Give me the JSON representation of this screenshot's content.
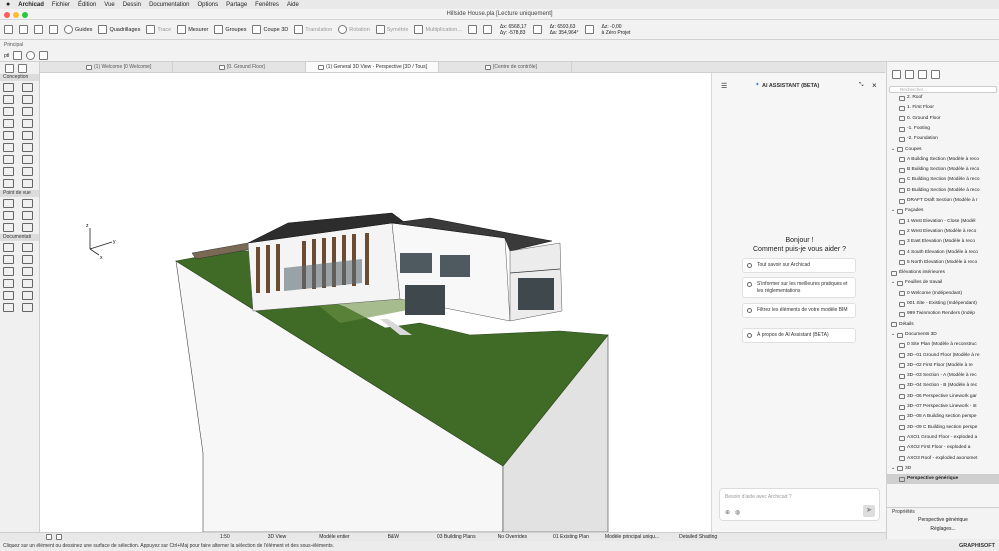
{
  "menubar": {
    "app": "Archicad",
    "items": [
      "Fichier",
      "Édition",
      "Vue",
      "Dessin",
      "Documentation",
      "Options",
      "Partage",
      "Fenêtres",
      "Aide"
    ]
  },
  "window": {
    "title": "Hillside House.pla [Lecture uniquement]"
  },
  "toolbar": {
    "guides": "Guides",
    "quadrillages": "Quadrillages",
    "trace": "Trace",
    "mesurer": "Mesurer",
    "groupes": "Groupes",
    "coupe3d": "Coupe 3D",
    "translation": "Translation",
    "rotation": "Rotation",
    "symetrie": "Symétrie",
    "multiplication": "Multiplication...",
    "dx": "Δx: 6568,17",
    "dy": "Δy: -578,83",
    "dr": "Δr: 6593,63",
    "da": "Δa: 354,964°",
    "dz": "Δz: -0,00",
    "zref": "à Zéro Projet"
  },
  "subtoolbar": {
    "label": "Principal",
    "field": "ptl"
  },
  "tabs": [
    {
      "label": "(1) Welcome [0 Welcome]"
    },
    {
      "label": "[0. Ground Floor]"
    },
    {
      "label": "(1) General 3D View - Perspective [3D / Tous]"
    },
    {
      "label": "[Centre de contrôle]"
    }
  ],
  "toolbox": {
    "conception": "Conception",
    "point_de_vue": "Point de vue",
    "documentation": "Documentati"
  },
  "viewport": {
    "axis_z": "z",
    "axis_y": "y",
    "axis_x": "x"
  },
  "ai": {
    "title": "AI ASSISTANT (BETA)",
    "greeting1": "Bonjour !",
    "greeting2": "Comment puis-je vous aider ?",
    "suggestions": [
      "Tout savoir sur Archicad",
      "S'informer sur les meilleures pratiques et les réglementations",
      "Filtrez les éléments de votre modèle BIM",
      "À propos de AI Assistant (BETA)"
    ],
    "input_placeholder": "Besoin d'aide avec Archicad ?"
  },
  "navigator": {
    "search_placeholder": "Rechercher...",
    "rows": [
      {
        "label": "2. Roof",
        "indent": 2,
        "type": "story"
      },
      {
        "label": "1. First Floor",
        "indent": 2,
        "type": "story"
      },
      {
        "label": "0. Ground Floor",
        "indent": 2,
        "type": "story"
      },
      {
        "label": "-1. Footing",
        "indent": 2,
        "type": "story"
      },
      {
        "label": "-2. Foundation",
        "indent": 2,
        "type": "story"
      },
      {
        "label": "Coupes",
        "indent": 1,
        "type": "folder"
      },
      {
        "label": "A Building Section (Modèle à reco",
        "indent": 2,
        "type": "view"
      },
      {
        "label": "B Building Section (Modèle à reco",
        "indent": 2,
        "type": "view"
      },
      {
        "label": "C Building Section (Modèle à reco",
        "indent": 2,
        "type": "view"
      },
      {
        "label": "D Building Section (Modèle à reco",
        "indent": 2,
        "type": "view"
      },
      {
        "label": "DRAFT Draft Section (Modèle à r",
        "indent": 2,
        "type": "view"
      },
      {
        "label": "Façades",
        "indent": 1,
        "type": "folder"
      },
      {
        "label": "1 West Elevation - Close (Modèl",
        "indent": 2,
        "type": "view"
      },
      {
        "label": "2 West Elevation (Modèle à reco",
        "indent": 2,
        "type": "view"
      },
      {
        "label": "3 East Elevation (Modèle à reco",
        "indent": 2,
        "type": "view"
      },
      {
        "label": "4 South Elevation (Modèle à reco",
        "indent": 2,
        "type": "view"
      },
      {
        "label": "5 North Elevation (Modèle à reco",
        "indent": 2,
        "type": "view"
      },
      {
        "label": "Élévations intérieures",
        "indent": 1,
        "type": "leaf"
      },
      {
        "label": "Feuilles de travail",
        "indent": 1,
        "type": "folder"
      },
      {
        "label": "0 Welcome (Indépendant)",
        "indent": 2,
        "type": "view"
      },
      {
        "label": "001 Site - Existing (Indépendant)",
        "indent": 2,
        "type": "view"
      },
      {
        "label": "999 Twinmotion Renders (Indép",
        "indent": 2,
        "type": "view"
      },
      {
        "label": "Détails",
        "indent": 1,
        "type": "leaf"
      },
      {
        "label": "Documents 3D",
        "indent": 1,
        "type": "folder"
      },
      {
        "label": "0 Site Plan (Modèle à reconstruc",
        "indent": 2,
        "type": "view"
      },
      {
        "label": "3D--01 Ground Floor (Modèle à re",
        "indent": 2,
        "type": "view"
      },
      {
        "label": "3D--02 First Floor (Modèle à re",
        "indent": 2,
        "type": "view"
      },
      {
        "label": "3D--03 Section - A (Modèle à rec",
        "indent": 2,
        "type": "view"
      },
      {
        "label": "3D--04 Section - B (Modèle à rec",
        "indent": 2,
        "type": "view"
      },
      {
        "label": "3D--06 Perspective Linework gar",
        "indent": 2,
        "type": "view"
      },
      {
        "label": "3D--07 Perspective Linework - st",
        "indent": 2,
        "type": "view"
      },
      {
        "label": "3D--08 A Building section perspe",
        "indent": 2,
        "type": "view"
      },
      {
        "label": "3D--09 C Building section perspe",
        "indent": 2,
        "type": "view"
      },
      {
        "label": "AXO1 Ground Floor - exploded a",
        "indent": 2,
        "type": "view"
      },
      {
        "label": "AXO2 First Floor - exploded a",
        "indent": 2,
        "type": "view"
      },
      {
        "label": "AXO3 Roof - exploded axonomet",
        "indent": 2,
        "type": "view"
      },
      {
        "label": "3D",
        "indent": 1,
        "type": "folder"
      },
      {
        "label": "Perspective générique",
        "indent": 2,
        "type": "view",
        "selected": true
      }
    ]
  },
  "properties": {
    "header": "Propriétés",
    "value": "Perspective générique",
    "button": "Réglages..."
  },
  "statusbar": {
    "zoom": "1:50",
    "view": "3D View",
    "model": "Modèle entier",
    "pen": "B&W",
    "layers": "03 Building Plans",
    "overrides": "No Overrides",
    "reno": "01 Existing Plan",
    "mvo": "Modèle principal uniqu...",
    "shading": "Detailed Shading"
  },
  "statusline": {
    "text": "Cliquez sur un élément ou dessinez une surface de sélection. Appuyez sur Ctrl+Maj pour faire alterner la sélection de l'élément et des sous-éléments.",
    "brand": "GRAPHISOFT"
  }
}
